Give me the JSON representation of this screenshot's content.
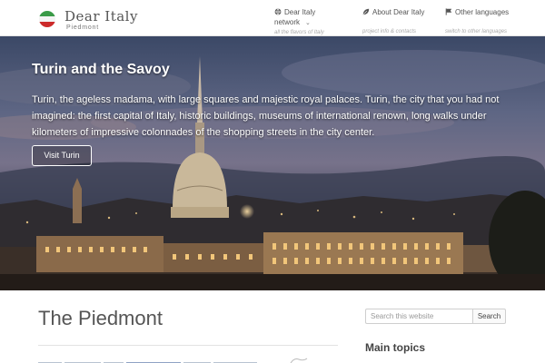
{
  "brand": {
    "title": "Dear Italy",
    "subtitle": "Piedmont",
    "flag_colors": [
      "#3a9a47",
      "#ffffff",
      "#cc2b2b"
    ]
  },
  "nav": [
    {
      "icon": "globe-icon",
      "label": "Dear Italy network",
      "chevron": "⌄",
      "sublabel": "all the flavors of Italy"
    },
    {
      "icon": "leaf-icon",
      "label": "About Dear Italy",
      "chevron": "",
      "sublabel": "project info & contacts"
    },
    {
      "icon": "flag-icon",
      "label": "Other languages",
      "chevron": "",
      "sublabel": "switch to other languages"
    }
  ],
  "hero": {
    "title": "Turin and the Savoy",
    "text": "Turin, the ageless madama, with large squares and majestic royal palaces. Turin, the city that you had not imagined: the first capital of Italy, historic buildings, museums of international renown, long walks under kilometers of impressive colonnades of the shopping streets in the city center.",
    "button": "Visit Turin"
  },
  "main": {
    "title": "The Piedmont"
  },
  "sidebar": {
    "search_placeholder": "Search this website",
    "search_button": "Search",
    "heading": "Main topics"
  },
  "colors": {
    "header_bg": "#ffffff",
    "text": "#555555",
    "sky": "#4a5472",
    "city_lights": "#f2c67a"
  }
}
